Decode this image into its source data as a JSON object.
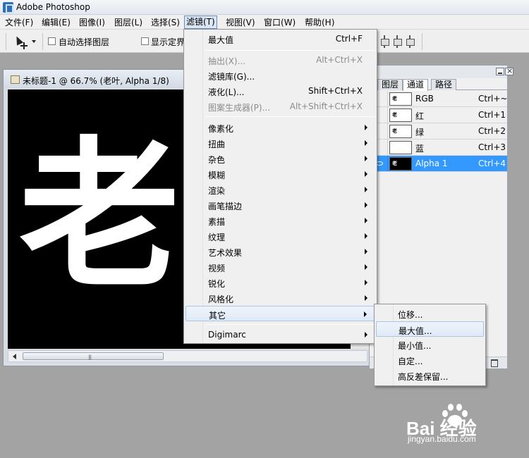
{
  "app": {
    "title": "Adobe Photoshop"
  },
  "menubar": {
    "items": [
      "文件(F)",
      "编辑(E)",
      "图像(I)",
      "图层(L)",
      "选择(S)",
      "滤镜(T)",
      "视图(V)",
      "窗口(W)",
      "帮助(H)"
    ],
    "active": "滤镜(T)"
  },
  "options": {
    "auto_select_label": "自动选择图层",
    "show_transform_label": "显示定界"
  },
  "document": {
    "title": "未标题-1 @ 66.7% (老叶, Alpha 1/8)",
    "canvas_text": "老",
    "scroll_grip": "|||"
  },
  "filter_menu": {
    "items": [
      {
        "label": "最大值",
        "shortcut": "Ctrl+F",
        "disabled": false
      },
      {
        "label": "抽出(X)...",
        "shortcut": "Alt+Ctrl+X",
        "disabled": true
      },
      {
        "label": "滤镜库(G)...",
        "shortcut": "",
        "disabled": false
      },
      {
        "label": "液化(L)...",
        "shortcut": "Shift+Ctrl+X",
        "disabled": false
      },
      {
        "label": "图案生成器(P)...",
        "shortcut": "Alt+Shift+Ctrl+X",
        "disabled": true
      },
      {
        "label": "像素化",
        "submenu": true
      },
      {
        "label": "扭曲",
        "submenu": true
      },
      {
        "label": "杂色",
        "submenu": true
      },
      {
        "label": "模糊",
        "submenu": true
      },
      {
        "label": "渲染",
        "submenu": true
      },
      {
        "label": "画笔描边",
        "submenu": true
      },
      {
        "label": "素描",
        "submenu": true
      },
      {
        "label": "纹理",
        "submenu": true
      },
      {
        "label": "艺术效果",
        "submenu": true
      },
      {
        "label": "视频",
        "submenu": true
      },
      {
        "label": "锐化",
        "submenu": true
      },
      {
        "label": "风格化",
        "submenu": true
      },
      {
        "label": "其它",
        "submenu": true,
        "highlighted": true
      },
      {
        "label": "Digimarc",
        "submenu": true
      }
    ]
  },
  "other_submenu": {
    "items": [
      "位移...",
      "最大值...",
      "最小值...",
      "自定...",
      "高反差保留..."
    ],
    "highlighted": "最大值..."
  },
  "channels_panel": {
    "tabs": [
      "图层",
      "通道",
      "路径"
    ],
    "active_tab": "通道",
    "channels": [
      {
        "name": "RGB",
        "shortcut": "Ctrl+~"
      },
      {
        "name": "红",
        "shortcut": "Ctrl+1"
      },
      {
        "name": "绿",
        "shortcut": "Ctrl+2"
      },
      {
        "name": "蓝",
        "shortcut": "Ctrl+3"
      },
      {
        "name": "Alpha 1",
        "shortcut": "Ctrl+4",
        "selected": true
      }
    ],
    "thumb_glyph": "老"
  },
  "watermark": {
    "brand": "Bai 经验",
    "url": "jingyan.baidu.com"
  },
  "colors": {
    "selection": "#3399ff",
    "workspace": "#a3a3a3",
    "menu_bg": "#f0f0f0"
  }
}
